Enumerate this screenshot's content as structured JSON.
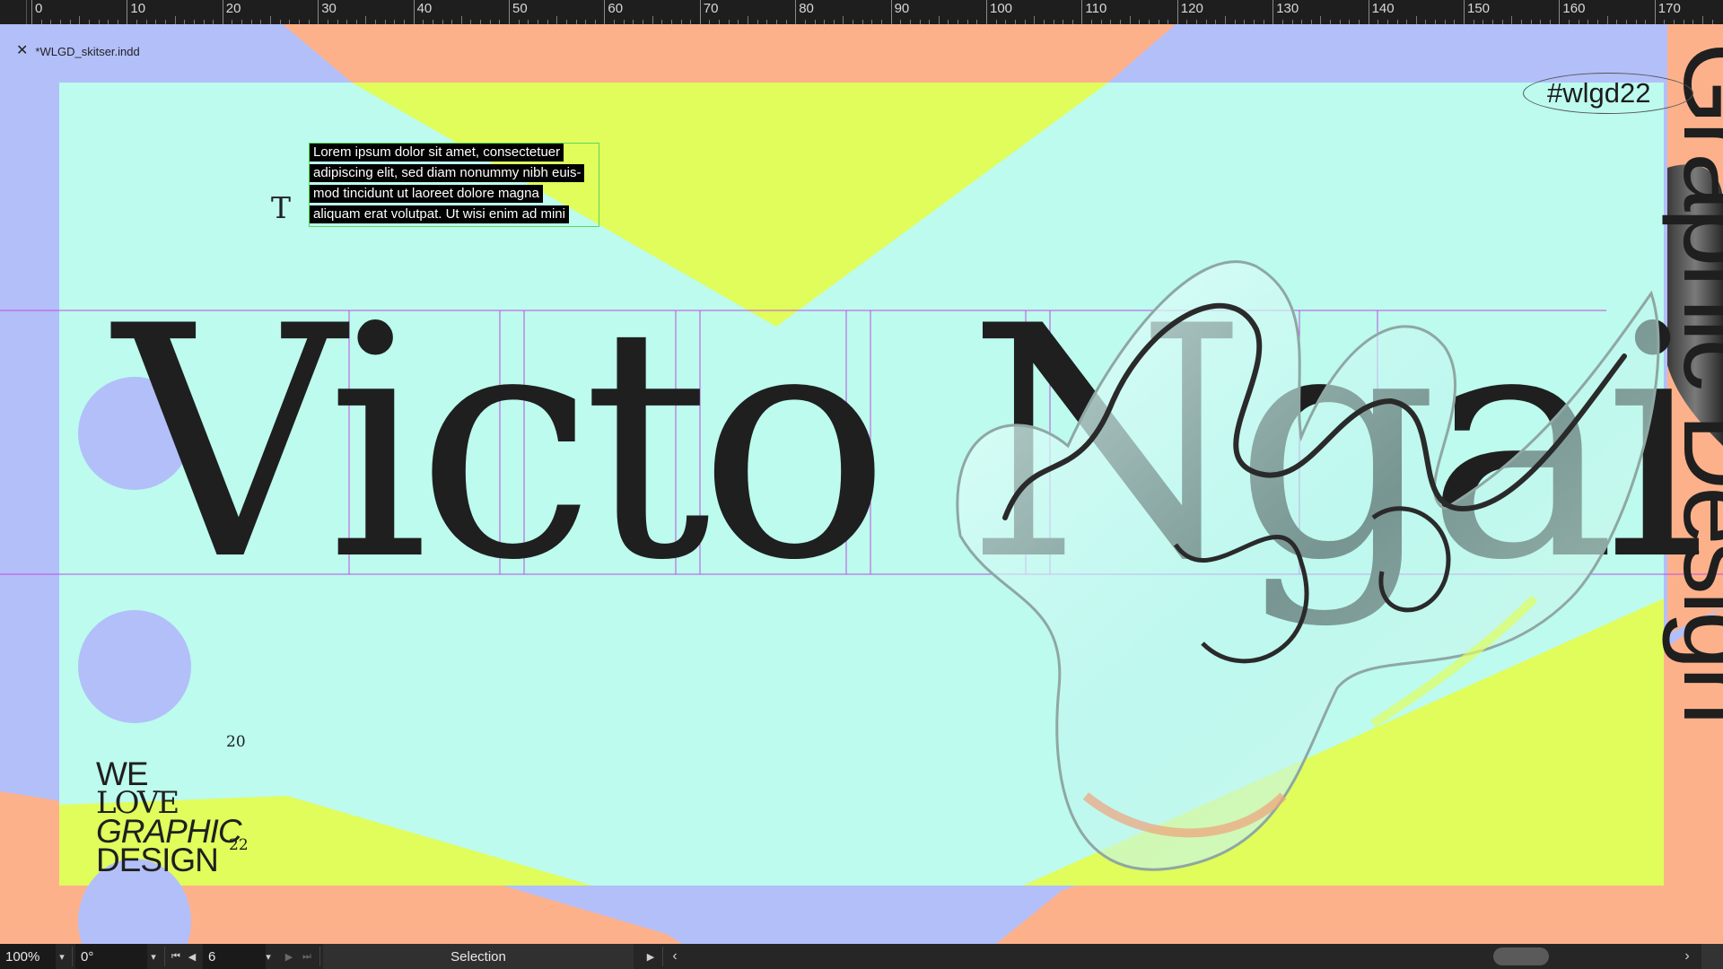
{
  "ruler": {
    "labels": [
      "0",
      "10",
      "20",
      "30",
      "40",
      "50",
      "60",
      "70",
      "80",
      "90",
      "100",
      "110",
      "120",
      "130",
      "140",
      "150",
      "160",
      "170"
    ]
  },
  "document": {
    "tab_name": "*WLGD_skitser.indd"
  },
  "artwork": {
    "hashtag": "#wlgd22",
    "name_text": "Victo Ngai",
    "lorem_lines": [
      "Lorem ipsum dolor sit amet, consectetuer",
      "adipiscing elit, sed diam nonummy nibh euis-",
      "mod tincidunt ut laoreet dolore magna",
      "aliquam erat volutpat. Ut wisi enim ad mini"
    ],
    "text_tool_glyph": "T",
    "logo": {
      "line1": "WE",
      "line2": "LOVE",
      "line3": "GRAPHIC",
      "line4": "DESIGN",
      "year_top": "20",
      "year_bottom": "22"
    },
    "vertical_text": "Graphic Design"
  },
  "statusbar": {
    "zoom": "100%",
    "angle": "0°",
    "page": "6",
    "mode": "Selection"
  },
  "colors": {
    "periwinkle": "#b3bff9",
    "peach": "#fdb18b",
    "mint": "#bcfbee",
    "lime": "#e0fd5c",
    "guide": "#c04ee0",
    "ink": "#1f1f1f"
  },
  "icons": {
    "close": "close-icon",
    "first_page": "first-page-icon",
    "prev_page": "prev-page-icon",
    "next_page": "next-page-icon",
    "last_page": "last-page-icon",
    "play": "play-icon",
    "scroll_left": "scroll-left-icon",
    "scroll_right": "scroll-right-icon"
  }
}
